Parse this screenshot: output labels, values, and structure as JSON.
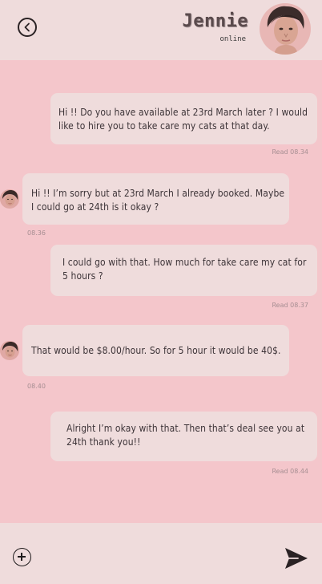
{
  "header": {
    "contact_name": "Jennie",
    "status": "online"
  },
  "messages": [
    {
      "side": "right",
      "lines": [
        "Hi !! Do you have available at 23rd March later ? I would",
        "like to hire you to take care my cats at that day."
      ],
      "timestamp": "Read 08.34"
    },
    {
      "side": "left",
      "lines": [
        "Hi !! I’m sorry but at 23rd March I already booked. Maybe",
        "I could go at 24th is it okay ?"
      ],
      "timestamp": "08.36"
    },
    {
      "side": "right",
      "lines": [
        "I could go with that. How much for take care my cat for",
        "5 hours ?"
      ],
      "timestamp": "Read 08.37"
    },
    {
      "side": "left",
      "lines": [
        "That would be $8.00/hour. So for 5 hour it would be 40$."
      ],
      "timestamp": "08.40"
    },
    {
      "side": "right",
      "lines": [
        "Alright I’m okay with that. Then that’s deal see you at",
        "24th thank you!!"
      ],
      "timestamp": "Read 08.44"
    }
  ],
  "composer": {
    "value": "",
    "placeholder": ""
  },
  "icons": {
    "back": "chevron-left-circle-icon",
    "add": "plus-circle-icon",
    "send": "send-icon"
  },
  "colors": {
    "background": "#f4c6cb",
    "bubble": "#efdcdc",
    "bars": "#efdcdc",
    "timestamp": "#a68e92"
  }
}
